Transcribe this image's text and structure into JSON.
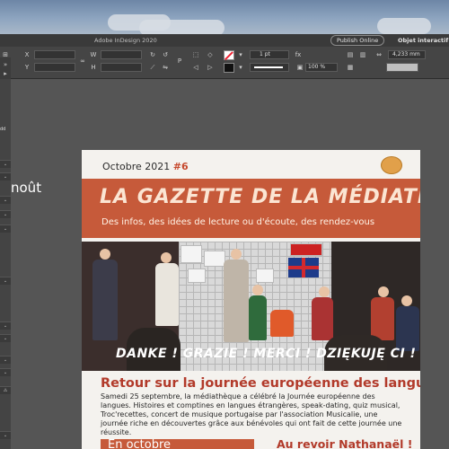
{
  "app": {
    "title": "Adobe InDesign 2020",
    "publish_label": "Publish Online",
    "panel_title": "Objet interactif po"
  },
  "control_panel": {
    "stroke_weight": "1 pt",
    "zoom": "100 %",
    "measure": "4,233 mm"
  },
  "left_panel": {
    "label_1": "dd"
  },
  "canvas": {
    "side_text": "noût"
  },
  "document": {
    "issue_prefix": "Octobre 2021",
    "issue_number": "#6",
    "masthead": "LA GAZETTE DE LA MÉDIATHÈQUE",
    "tagline": "Des infos, des idées de lecture ou d'écoute, des rendez-vous",
    "photo_caption": "DANKE ! GRAZIE ! MERCI ! DZIĘKUJĘ CI ! THANKS !",
    "article_title": "Retour sur la journée européenne des langues",
    "article_body": "Samedi 25 septembre, la médiathèque a célébré la Journée européenne des langues. Histoires et comptines en langues étrangères, speak-dating, quiz musical, Troc'recettes, concert de musique portugaise par l'association Musicalie, une journée riche en découvertes grâce aux bénévoles qui ont fait de cette journée une réussite.",
    "box_heading": "En octobre",
    "side_heading": "Au revoir Nathanaël !"
  },
  "colors": {
    "accent": "#c65a3a",
    "title_red": "#b23a2a",
    "ui_dark": "#3a3a3a"
  }
}
